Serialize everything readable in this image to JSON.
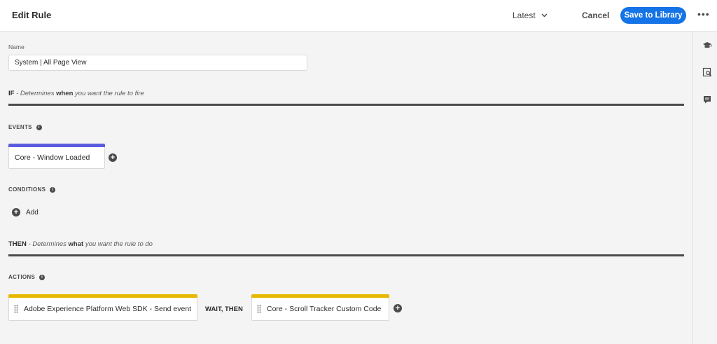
{
  "header": {
    "title": "Edit Rule",
    "version": "Latest",
    "cancel": "Cancel",
    "save": "Save to Library",
    "more": "•••"
  },
  "rail": {
    "icons": [
      "learn-icon",
      "search-preview-icon",
      "comment-icon"
    ]
  },
  "form": {
    "name_label": "Name",
    "name_value": "System | All Page View"
  },
  "if_section": {
    "keyword": "IF",
    "text_pre": "- Determines",
    "text_em": "when",
    "text_post": "you want the rule to fire"
  },
  "events": {
    "caption": "EVENTS",
    "items": [
      {
        "label": "Core - Window Loaded",
        "color": "#5c5ce0"
      }
    ]
  },
  "conditions": {
    "caption": "CONDITIONS",
    "add_label": "Add"
  },
  "then_section": {
    "keyword": "THEN",
    "text_pre": "- Determines",
    "text_em": "what",
    "text_post": "you want the rule to do"
  },
  "actions": {
    "caption": "ACTIONS",
    "items": [
      {
        "label": "Adobe Experience Platform Web SDK - Send event",
        "color": "#e6b800"
      },
      {
        "label": "Core - Scroll Tracker Custom Code",
        "color": "#e6b800"
      }
    ],
    "connector": "WAIT, THEN"
  },
  "colors": {
    "accent": "#1473e6",
    "divider": "#4b4b4b"
  }
}
